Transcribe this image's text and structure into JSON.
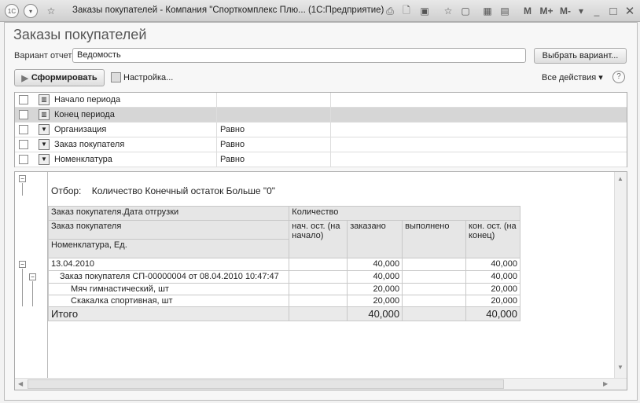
{
  "window": {
    "title": "Заказы покупателей - Компания \"Спорткомплекс Плю... (1С:Предприятие)",
    "m": "M",
    "mplus": "M+",
    "mminus": "M-"
  },
  "page_title": "Заказы покупателей",
  "variant": {
    "label": "Вариант отчета:",
    "value": "Ведомость",
    "choose_button": "Выбрать вариант..."
  },
  "toolbar": {
    "generate": "Сформировать",
    "settings": "Настройка...",
    "all_actions": "Все действия",
    "help": "?"
  },
  "settings_rows": [
    {
      "name": "Начало периода",
      "condition": ""
    },
    {
      "name": "Конец периода",
      "condition": ""
    },
    {
      "name": "Организация",
      "condition": "Равно"
    },
    {
      "name": "Заказ покупателя",
      "condition": "Равно"
    },
    {
      "name": "Номенклатура",
      "condition": "Равно"
    }
  ],
  "report": {
    "filter_label": "Отбор:",
    "filter_value": "Количество Конечный остаток Больше \"0\"",
    "headers": {
      "group1": "Заказ покупателя.Дата отгрузки",
      "group2": "Заказ покупателя",
      "group3": "Номенклатура, Ед.",
      "quantity": "Количество",
      "start": "нач. ост. (на начало)",
      "ordered": "заказано",
      "done": "выполнено",
      "end": "кон. ост. (на конец)"
    },
    "rows": [
      {
        "name": "13.04.2010",
        "start": "",
        "ordered": "40,000",
        "done": "",
        "end": "40,000"
      },
      {
        "name": "Заказ покупателя СП-00000004 от 08.04.2010 10:47:47",
        "start": "",
        "ordered": "40,000",
        "done": "",
        "end": "40,000"
      },
      {
        "name": "Мяч гимнастический, шт",
        "start": "",
        "ordered": "20,000",
        "done": "",
        "end": "20,000"
      },
      {
        "name": "Скакалка спортивная, шт",
        "start": "",
        "ordered": "20,000",
        "done": "",
        "end": "20,000"
      }
    ],
    "total": {
      "name": "Итого",
      "start": "",
      "ordered": "40,000",
      "done": "",
      "end": "40,000"
    }
  }
}
